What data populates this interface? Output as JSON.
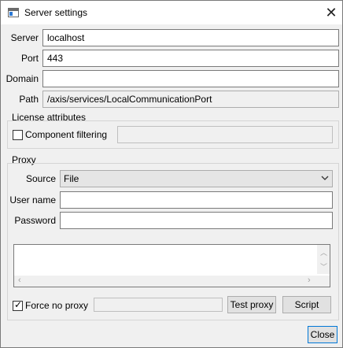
{
  "window": {
    "title": "Server settings",
    "close_glyph": "✕"
  },
  "server": {
    "server_label": "Server",
    "server_value": "localhost",
    "port_label": "Port",
    "port_value": "443",
    "domain_label": "Domain",
    "domain_value": "",
    "path_label": "Path",
    "path_value": "/axis/services/LocalCommunicationPort"
  },
  "license": {
    "title": "License attributes",
    "component_filtering_label": "Component filtering",
    "component_filtering_checked": false,
    "component_filtering_value": ""
  },
  "proxy": {
    "title": "Proxy",
    "source_label": "Source",
    "source_value": "File",
    "username_label": "User name",
    "username_value": "",
    "password_label": "Password",
    "password_value": "",
    "script_text": "",
    "force_no_proxy_label": "Force no proxy",
    "force_no_proxy_checked": true,
    "force_no_proxy_value": "",
    "test_proxy_label": "Test proxy",
    "script_label": "Script"
  },
  "footer": {
    "close_label": "Close"
  },
  "icons": [
    "app-icon",
    "close-icon",
    "checkbox-check-icon",
    "chevron-down-icon",
    "scroll-up-icon",
    "scroll-down-icon",
    "scroll-left-icon",
    "scroll-right-icon"
  ]
}
